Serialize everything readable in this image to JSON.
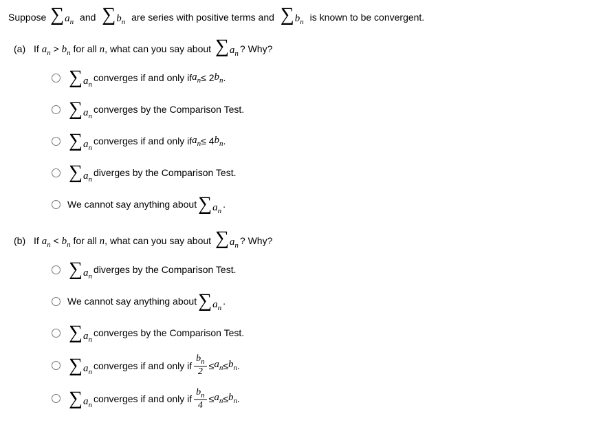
{
  "intro": {
    "t1": "Suppose",
    "t2": "and",
    "t3": "are series with positive terms and",
    "t4": "is known to be convergent."
  },
  "sigma": "∑",
  "terms": {
    "an": "a",
    "bn": "b",
    "sub_n": "n"
  },
  "partA": {
    "label": "(a)",
    "q1": "If ",
    "q_ineq": " > ",
    "q2": " for all ",
    "q_n": "n",
    "q3": ", what can you say about ",
    "q4": "? Why?",
    "options": [
      {
        "pre": "",
        "post": " converges if and only if ",
        "tail": "a",
        "tail_sub": "n",
        "tail2": " ≤ 2",
        "tail3": "b",
        "tail3_sub": "n",
        "tail4": "."
      },
      {
        "pre": "",
        "post": " converges by the Comparison Test."
      },
      {
        "pre": "",
        "post": " converges if and only if ",
        "tail": "a",
        "tail_sub": "n",
        "tail2": " ≤ 4",
        "tail3": "b",
        "tail3_sub": "n",
        "tail4": "."
      },
      {
        "pre": "",
        "post": " diverges by the Comparison Test."
      },
      {
        "plain": "We cannot say anything about ",
        "sigma_after": true,
        "dot": "."
      }
    ]
  },
  "partB": {
    "label": "(b)",
    "q1": "If ",
    "q_ineq": " < ",
    "q2": " for all ",
    "q_n": "n",
    "q3": ", what can you say about ",
    "q4": "? Why?",
    "options": [
      {
        "post": " diverges by the Comparison Test."
      },
      {
        "plain": "We cannot say anything about ",
        "sigma_after": true,
        "dot": "."
      },
      {
        "post": " converges by the Comparison Test."
      },
      {
        "post": " converges if and only if ",
        "frac_num": "b",
        "frac_num_sub": "n",
        "frac_den": "2",
        "mid": " ≤ ",
        "tail": "a",
        "tail_sub": "n",
        "mid2": " ≤ ",
        "tail3": "b",
        "tail3_sub": "n",
        "tail4": "."
      },
      {
        "post": " converges if and only if ",
        "frac_num": "b",
        "frac_num_sub": "n",
        "frac_den": "4",
        "mid": " ≤ ",
        "tail": "a",
        "tail_sub": "n",
        "mid2": " ≤ ",
        "tail3": "b",
        "tail3_sub": "n",
        "tail4": "."
      }
    ]
  }
}
